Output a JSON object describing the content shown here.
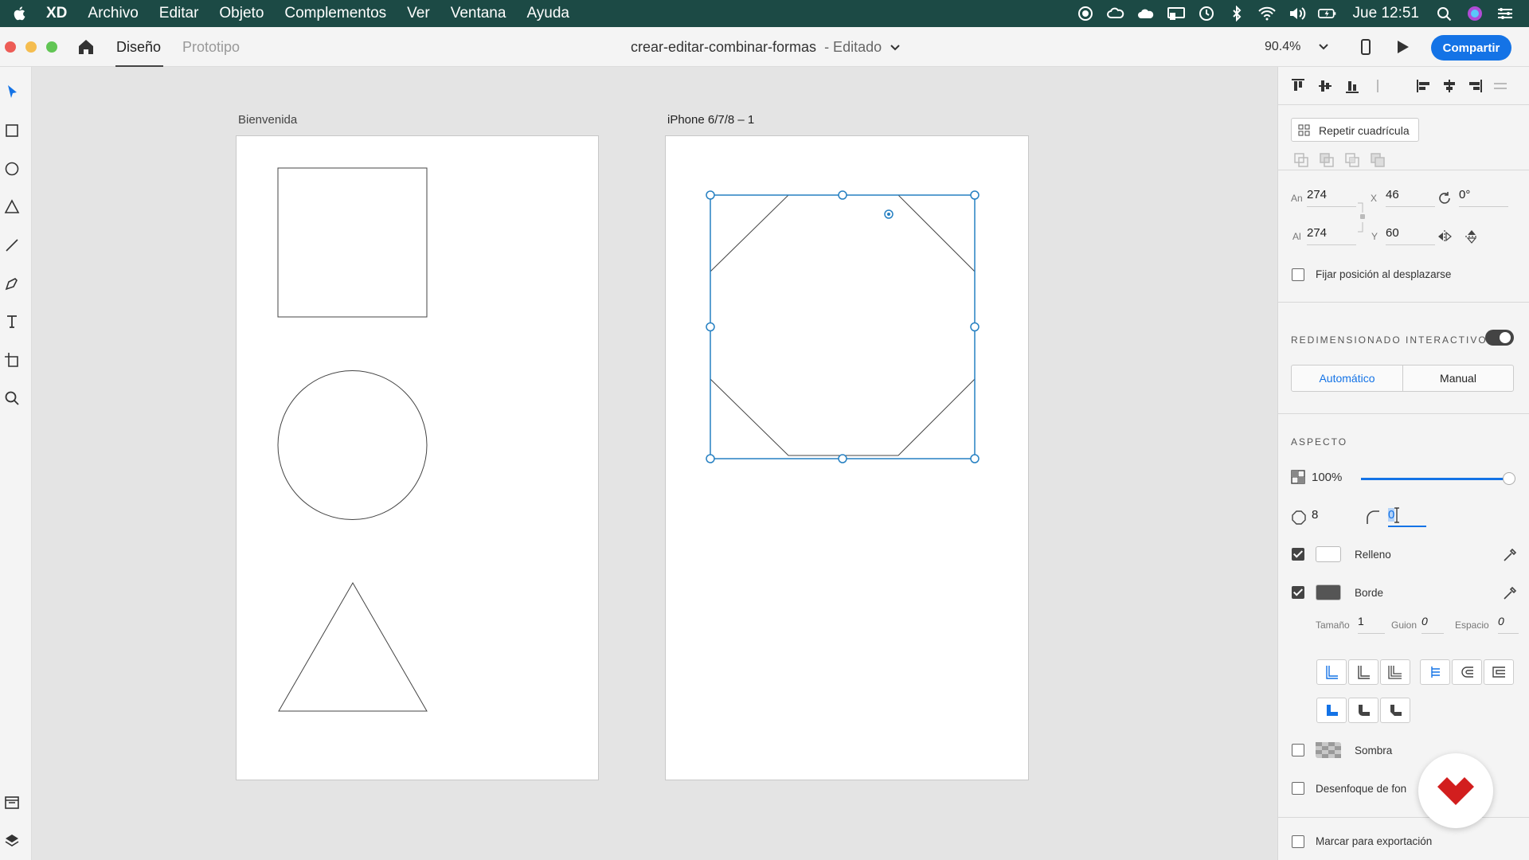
{
  "menubar": {
    "app_name": "XD",
    "menus": [
      "Archivo",
      "Editar",
      "Objeto",
      "Complementos",
      "Ver",
      "Ventana",
      "Ayuda"
    ],
    "clock": "Jue 12:51",
    "status_icons": [
      "record-icon",
      "creative-cloud-icon",
      "cloud-icon",
      "cast-icon",
      "time-machine-icon",
      "bluetooth-icon",
      "wifi-icon",
      "volume-icon",
      "battery-icon",
      "search-icon",
      "siri-icon",
      "control-center-icon"
    ]
  },
  "titlebar": {
    "tabs": [
      "Diseño",
      "Prototipo"
    ],
    "active_tab": "Diseño",
    "document_name": "crear-editar-combinar-formas",
    "document_status": "- Editado",
    "zoom": "90.4%",
    "share_label": "Compartir"
  },
  "toolbar": {
    "tools": [
      "select-icon",
      "rectangle-icon",
      "ellipse-icon",
      "triangle-icon",
      "line-icon",
      "pen-icon",
      "text-icon",
      "artboard-icon",
      "zoom-icon"
    ],
    "bottom_tools": [
      "assets-icon",
      "layers-icon"
    ]
  },
  "canvas": {
    "artboards": [
      {
        "label": "Bienvenida",
        "shapes": [
          "square",
          "circle",
          "triangle"
        ]
      },
      {
        "label": "iPhone 6/7/8 – 1",
        "shapes": [
          "octagon"
        ]
      }
    ]
  },
  "panel": {
    "repeat_grid_label": "Repetir cuadrícula",
    "width_label": "An",
    "width": "274",
    "height_label": "Al",
    "height": "274",
    "x_label": "X",
    "x": "46",
    "y_label": "Y",
    "y": "60",
    "rotation": "0°",
    "fix_position_label": "Fijar posición al desplazarse",
    "responsive_title": "REDIMENSIONADO INTERACTIVO",
    "responsive_on": true,
    "resize_auto": "Automático",
    "resize_manual": "Manual",
    "appearance_title": "ASPECTO",
    "opacity": "100%",
    "opacity_fraction": 1.0,
    "corners": "8",
    "corner_radius": "0",
    "fill_label": "Relleno",
    "fill_color": "#ffffff",
    "border_label": "Borde",
    "border_color": "#555555",
    "size_label": "Tamaño",
    "size_value": "1",
    "dash_label": "Guion",
    "dash_value": "0",
    "gap_label": "Espacio",
    "gap_value": "0",
    "shadow_label": "Sombra",
    "blur_label": "Desenfoque de fon",
    "export_label": "Marcar para exportación"
  },
  "colors": {
    "menubar_bg": "#1c4a45",
    "accent": "#1473e6",
    "selection": "#2680c2",
    "logo_red": "#d21e1e"
  }
}
